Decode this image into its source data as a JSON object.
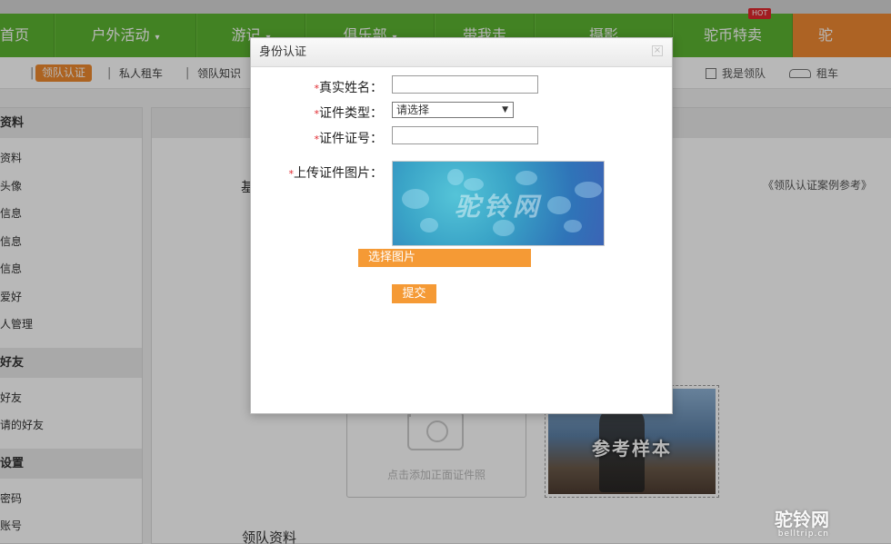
{
  "nav": {
    "items": [
      {
        "label": "首页",
        "caret": false
      },
      {
        "label": "户外活动",
        "caret": true
      },
      {
        "label": "游记",
        "caret": true
      },
      {
        "label": "俱乐部",
        "caret": true
      },
      {
        "label": "带我走",
        "caret": false
      },
      {
        "label": "摄影",
        "caret": false
      },
      {
        "label": "驼币特卖",
        "caret": false,
        "badge": "HOT"
      },
      {
        "label": "驼"
      }
    ],
    "caret_icon": "▾"
  },
  "subnav": {
    "active": "领队认证",
    "links": [
      "私人租车",
      "领队知识"
    ],
    "separator": "|",
    "right": {
      "leader": "我是领队",
      "rent": "租车"
    }
  },
  "sidebar": {
    "sections": [
      {
        "title": "资料",
        "items": [
          "资料",
          "头像",
          "信息",
          "信息",
          "信息",
          "爱好",
          "人管理"
        ]
      },
      {
        "title": "好友",
        "items": [
          "好友",
          "请的好友"
        ]
      },
      {
        "title": "设置",
        "items": [
          "密码",
          "账号"
        ]
      }
    ]
  },
  "main": {
    "heading_char": "基",
    "example_link": "《领队认证案例参考》",
    "upload_hint": "点击添加正面证件照",
    "sample_label": "参考样本",
    "leader_data_title": "领队资料"
  },
  "dialog": {
    "title": "身份认证",
    "close": "×",
    "required_mark": "*",
    "fields": {
      "real_name": {
        "label": "真实姓名：",
        "value": ""
      },
      "id_type": {
        "label": "证件类型：",
        "value": "请选择"
      },
      "id_number": {
        "label": "证件证号：",
        "value": ""
      },
      "upload": {
        "label": "上传证件图片："
      }
    },
    "preview_watermark": "驼铃网",
    "choose_button": "选择图片",
    "submit_button": "提交"
  },
  "watermark": {
    "brand": "驼铃网",
    "url": "belltrip.cn"
  },
  "colors": {
    "nav_green": "#5cb531",
    "accent_orange": "#f59a35",
    "required_red": "#e0272d"
  }
}
